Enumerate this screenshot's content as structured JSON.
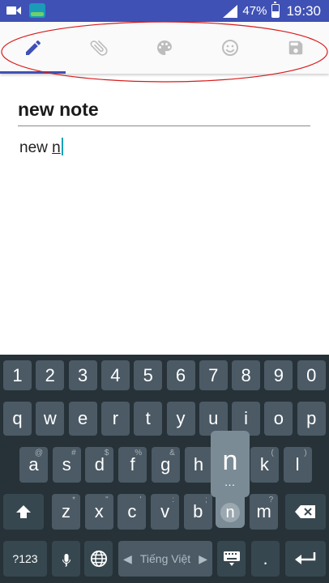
{
  "status_bar": {
    "battery": "47%",
    "time": "19:30",
    "battery_level": 0.47
  },
  "toolbar": {
    "tabs": [
      {
        "icon": "pencil-icon",
        "active": true
      },
      {
        "icon": "paperclip-icon",
        "active": false
      },
      {
        "icon": "palette-icon",
        "active": false
      },
      {
        "icon": "smiley-icon",
        "active": false
      },
      {
        "icon": "save-icon",
        "active": false
      }
    ],
    "accent_color": "#3f51b5",
    "annotation_color": "#d81b1b"
  },
  "note": {
    "title": "new note",
    "body_prefix": "new ",
    "body_word": "n"
  },
  "keyboard": {
    "row_numbers": [
      "1",
      "2",
      "3",
      "4",
      "5",
      "6",
      "7",
      "8",
      "9",
      "0"
    ],
    "row_top": [
      "q",
      "w",
      "e",
      "r",
      "t",
      "y",
      "u",
      "i",
      "o",
      "p"
    ],
    "row_home": [
      {
        "key": "a",
        "hint": "@"
      },
      {
        "key": "s",
        "hint": "#"
      },
      {
        "key": "d",
        "hint": "$"
      },
      {
        "key": "f",
        "hint": "%"
      },
      {
        "key": "g",
        "hint": "&"
      },
      {
        "key": "h",
        "hint": ""
      },
      {
        "key": "j",
        "hint": ""
      },
      {
        "key": "k",
        "hint": "("
      },
      {
        "key": "l",
        "hint": ")"
      }
    ],
    "row_bottom": [
      {
        "key": "z",
        "hint": "*"
      },
      {
        "key": "x",
        "hint": "\""
      },
      {
        "key": "c",
        "hint": "'"
      },
      {
        "key": "v",
        "hint": ":"
      },
      {
        "key": "b",
        "hint": ";"
      },
      {
        "key": "n",
        "hint": "!"
      },
      {
        "key": "m",
        "hint": "?"
      }
    ],
    "symbols_label": "?123",
    "comma": ",",
    "language": "Tiếng Việt",
    "period": ".",
    "popup_key": "n",
    "popup_more": "…"
  }
}
